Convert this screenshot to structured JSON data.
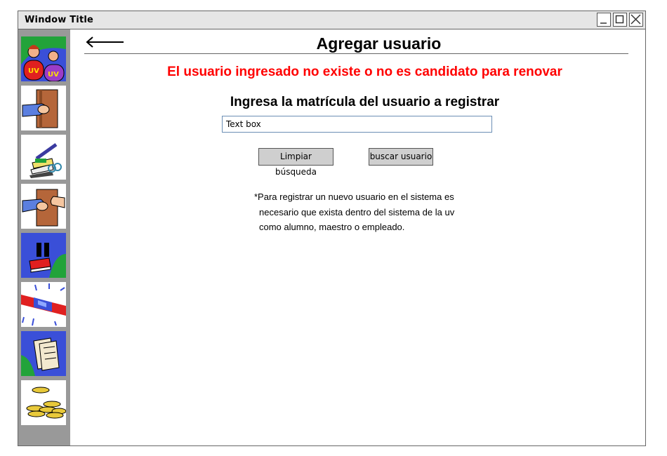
{
  "window": {
    "title": "Window Title",
    "controls": [
      "minimize",
      "maximize",
      "close"
    ]
  },
  "sidebar": {
    "items": [
      {
        "name": "users",
        "icon": "users-uv-icon"
      },
      {
        "name": "loan",
        "icon": "hand-book-icon"
      },
      {
        "name": "records",
        "icon": "books-pen-icon"
      },
      {
        "name": "return",
        "icon": "handover-book-icon"
      },
      {
        "name": "pause",
        "icon": "pause-book-icon"
      },
      {
        "name": "alert",
        "icon": "alarm-light-icon"
      },
      {
        "name": "documents",
        "icon": "documents-icon"
      },
      {
        "name": "fines",
        "icon": "coins-icon"
      }
    ]
  },
  "header": {
    "title": "Agregar usuario",
    "back_icon": "arrow-left-icon"
  },
  "main": {
    "error": "El usuario ingresado no existe o no es candidato para renovar",
    "prompt": "Ingresa la matrícula del usuario a registrar",
    "search_value": "Text box",
    "clear_button": "Limpiar búsqueda",
    "search_button": "buscar usuario",
    "note_lines": [
      "*Para registrar un nuevo usuario en el sistema es",
      "necesario que exista dentro del sistema de la uv",
      "como alumno, maestro o empleado."
    ]
  },
  "colors": {
    "error": "#ff0000",
    "sidebar": "#999999",
    "icon_blue": "#3a4fd8",
    "icon_green": "#22a33a"
  }
}
